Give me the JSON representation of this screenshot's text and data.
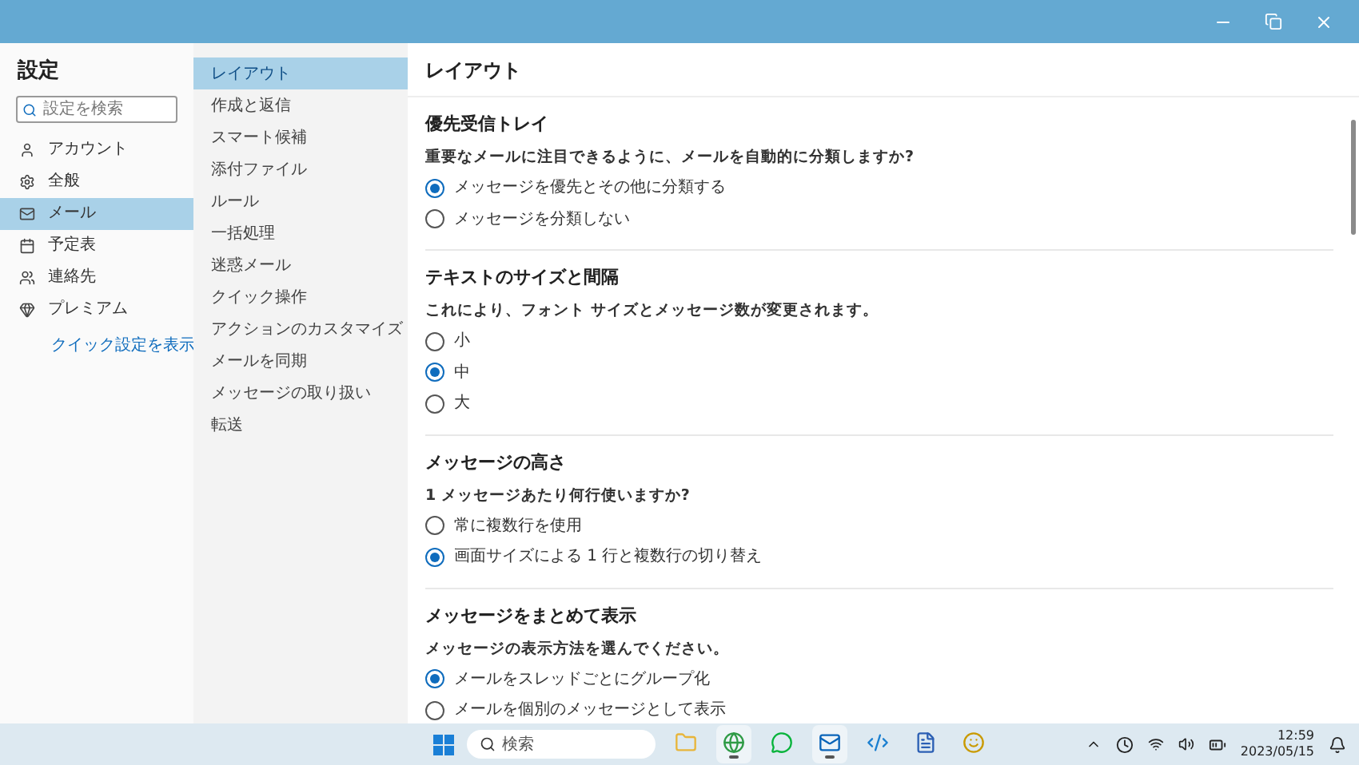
{
  "sidebar": {
    "title": "設定",
    "search": {
      "placeholder": "設定を検索"
    },
    "items": [
      {
        "kind": "account",
        "label": "アカウント",
        "selected": false
      },
      {
        "kind": "general",
        "label": "全般",
        "selected": false
      },
      {
        "kind": "mail",
        "label": "メール",
        "selected": true
      },
      {
        "kind": "calendar",
        "label": "予定表",
        "selected": false
      },
      {
        "kind": "people",
        "label": "連絡先",
        "selected": false
      },
      {
        "kind": "premium",
        "label": "プレミアム",
        "selected": false
      }
    ],
    "link": "クイック設定を表示"
  },
  "subnav": {
    "items": [
      {
        "label": "レイアウト",
        "selected": true
      },
      {
        "label": "作成と返信",
        "selected": false
      },
      {
        "label": "スマート候補",
        "selected": false
      },
      {
        "label": "添付ファイル",
        "selected": false
      },
      {
        "label": "ルール",
        "selected": false
      },
      {
        "label": "一括処理",
        "selected": false
      },
      {
        "label": "迷惑メール",
        "selected": false
      },
      {
        "label": "クイック操作",
        "selected": false
      },
      {
        "label": "アクションのカスタマイズ",
        "selected": false
      },
      {
        "label": "メールを同期",
        "selected": false
      },
      {
        "label": "メッセージの取り扱い",
        "selected": false
      },
      {
        "label": "転送",
        "selected": false
      }
    ]
  },
  "content": {
    "title": "レイアウト",
    "sections": [
      {
        "heading": "優先受信トレイ",
        "question": "重要なメールに注目できるように、メールを自動的に分類しますか?",
        "options": [
          {
            "label": "メッセージを優先とその他に分類する",
            "selected": true
          },
          {
            "label": "メッセージを分類しない",
            "selected": false
          }
        ]
      },
      {
        "heading": "テキストのサイズと間隔",
        "question": "これにより、フォント サイズとメッセージ数が変更されます。",
        "options": [
          {
            "label": "小",
            "selected": false
          },
          {
            "label": "中",
            "selected": true
          },
          {
            "label": "大",
            "selected": false
          }
        ]
      },
      {
        "heading": "メッセージの高さ",
        "question": "1 メッセージあたり何行使いますか?",
        "options": [
          {
            "label": "常に複数行を使用",
            "selected": false
          },
          {
            "label": "画面サイズによる 1 行と複数行の切り替え",
            "selected": true
          }
        ]
      },
      {
        "heading": "メッセージをまとめて表示",
        "question": "メッセージの表示方法を選んでください。",
        "options": [
          {
            "label": "メールをスレッドごとにグループ化",
            "selected": true
          },
          {
            "label": "メールを個別のメッセージとして表示",
            "selected": false
          }
        ]
      }
    ]
  },
  "taskbar": {
    "search": {
      "placeholder": "検索"
    },
    "apps": [
      {
        "kind": "folder",
        "running": false
      },
      {
        "kind": "browser",
        "running": true
      },
      {
        "kind": "chat",
        "running": false
      },
      {
        "kind": "mail",
        "running": true
      },
      {
        "kind": "code",
        "running": false
      },
      {
        "kind": "word",
        "running": false
      },
      {
        "kind": "game",
        "running": false
      }
    ],
    "time": "12:59",
    "date": "2023/05/15"
  }
}
